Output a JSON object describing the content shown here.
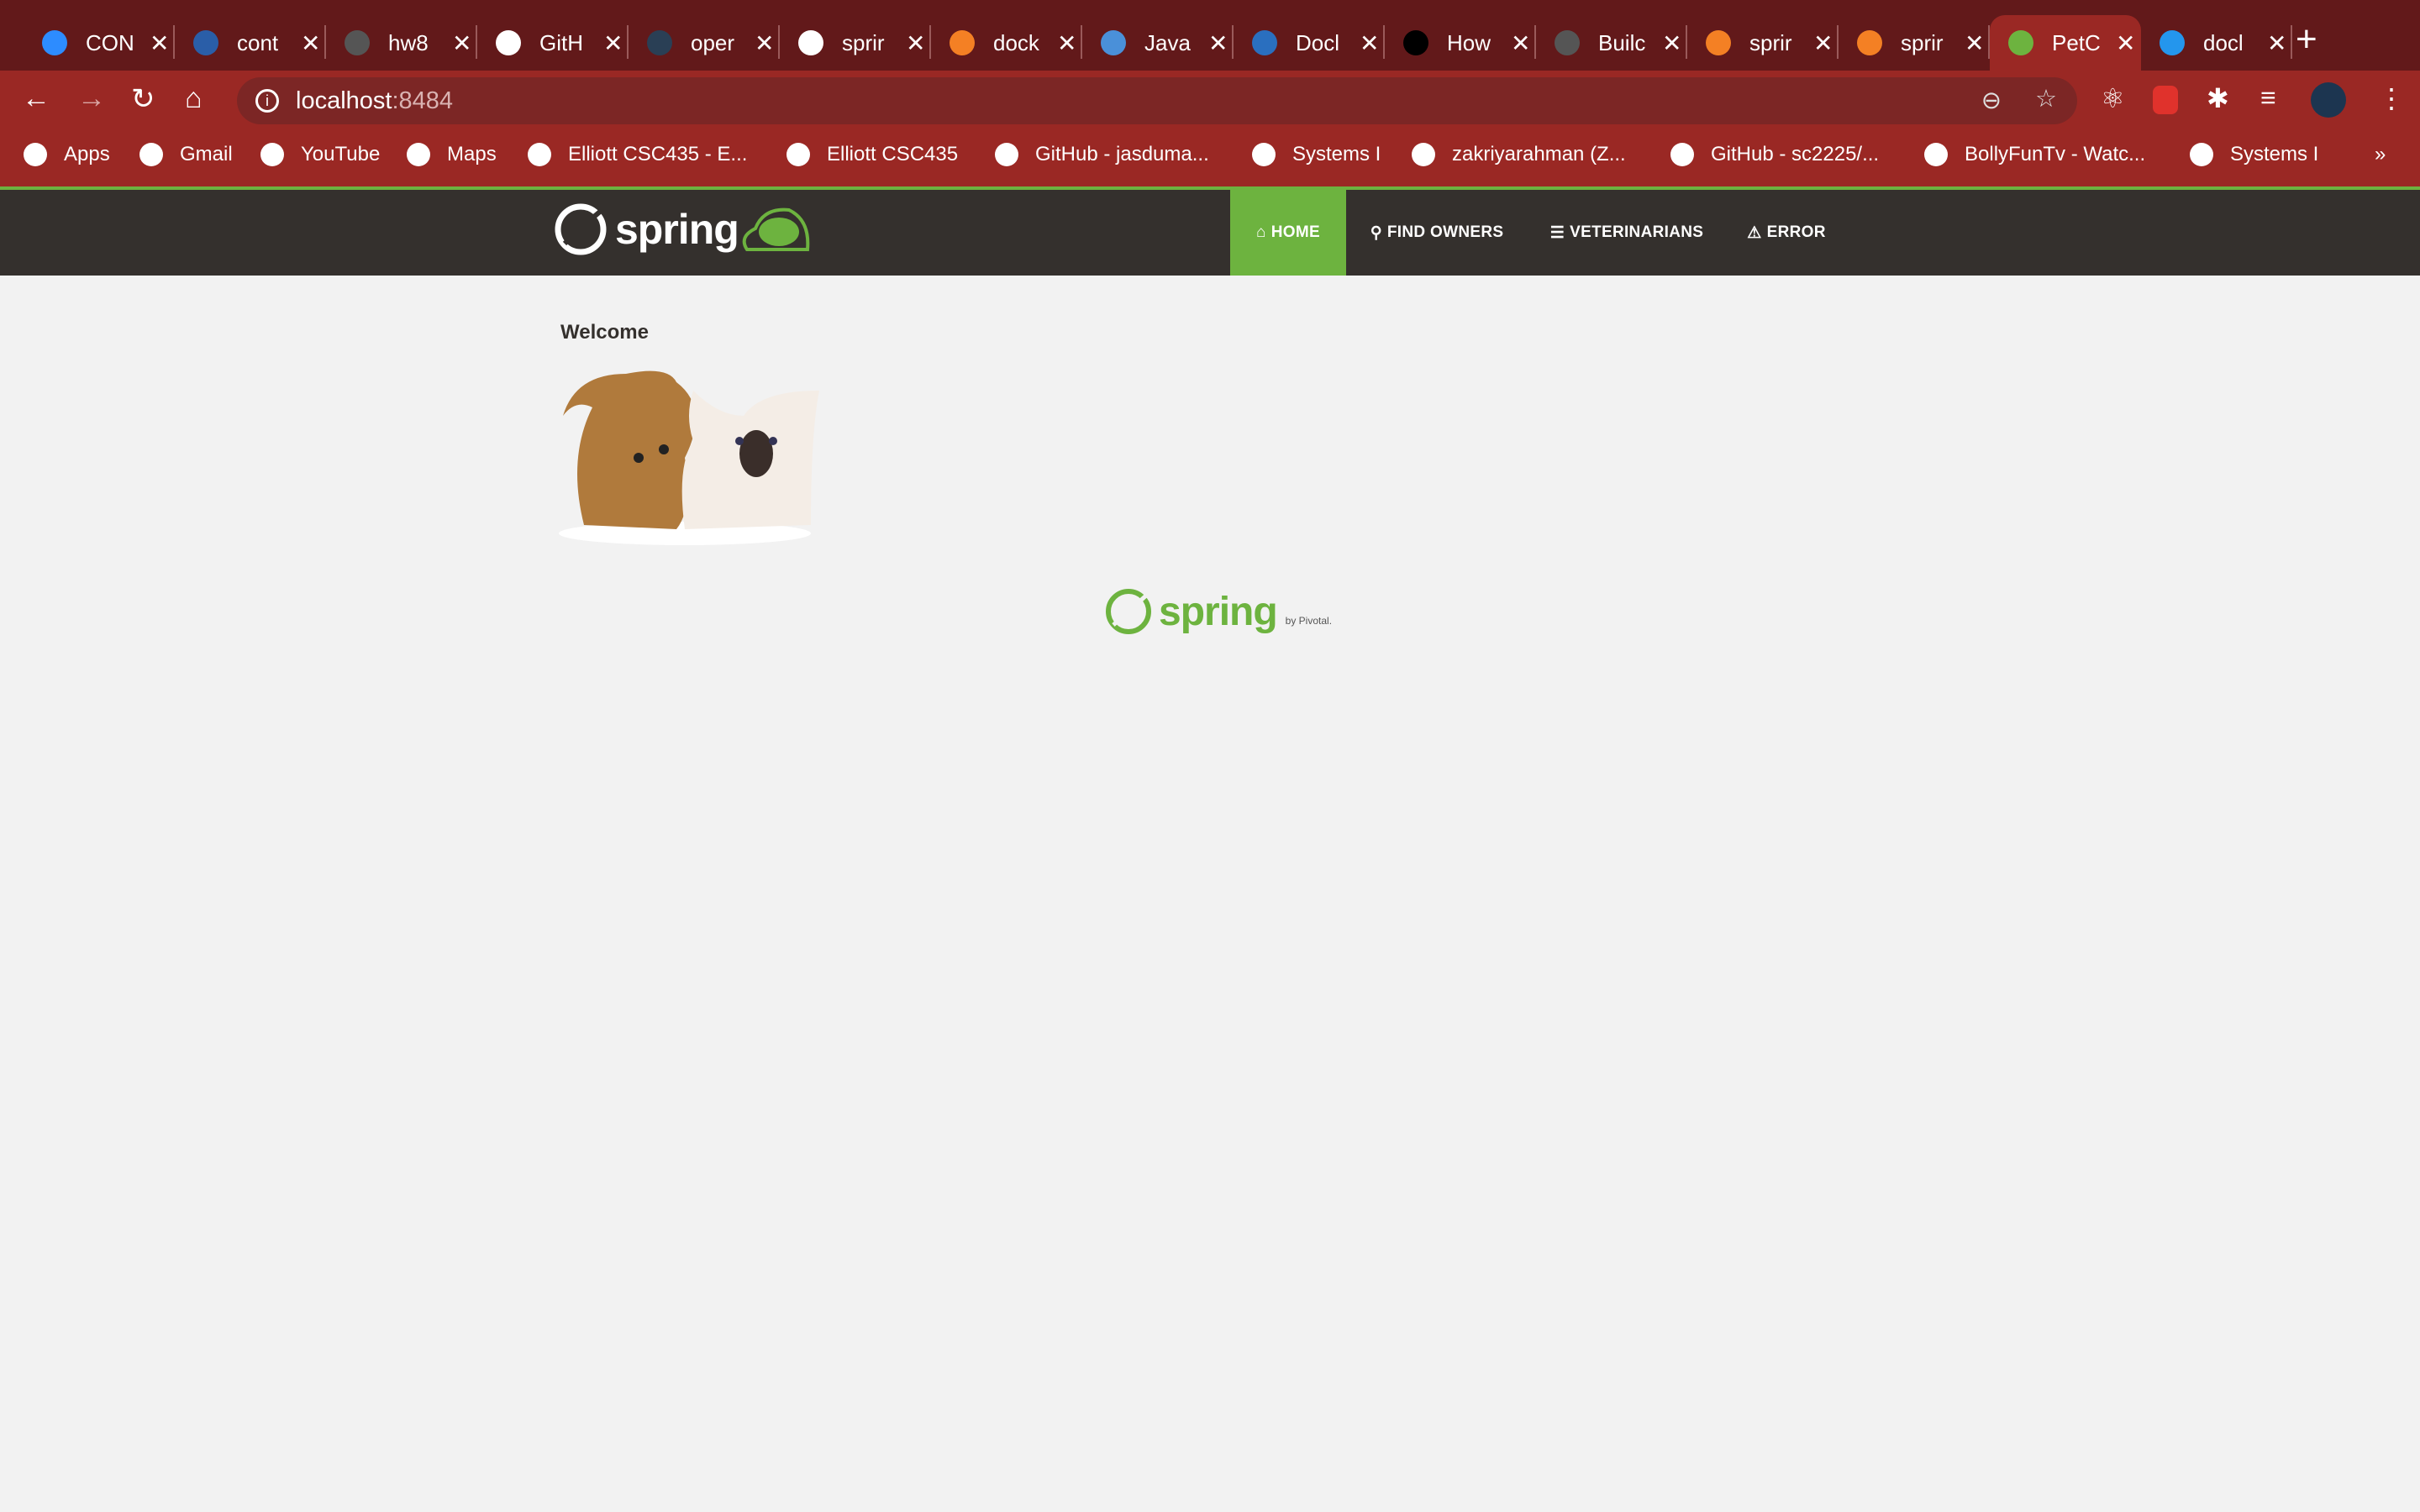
{
  "browser": {
    "tabs": [
      {
        "title": "CON",
        "icon": "zoom-icon",
        "color": "#2d8cff"
      },
      {
        "title": "cont",
        "icon": "shield-icon",
        "color": "#2a5ea8"
      },
      {
        "title": "hw8",
        "icon": "globe-icon",
        "color": "#555555"
      },
      {
        "title": "GitH",
        "icon": "github-icon",
        "color": "#ffffff"
      },
      {
        "title": "oper",
        "icon": "docker-icon",
        "color": "#2a3f55"
      },
      {
        "title": "sprir",
        "icon": "github-icon",
        "color": "#ffffff"
      },
      {
        "title": "dock",
        "icon": "stackoverflow-icon",
        "color": "#f48024"
      },
      {
        "title": "Java",
        "icon": "octopus-icon",
        "color": "#4a90d9"
      },
      {
        "title": "Docl",
        "icon": "network-icon",
        "color": "#2a6fbf"
      },
      {
        "title": "How",
        "icon": "medium-icon",
        "color": "#000000"
      },
      {
        "title": "Builc",
        "icon": "globe-icon",
        "color": "#555555"
      },
      {
        "title": "sprir",
        "icon": "stackoverflow-icon",
        "color": "#f48024"
      },
      {
        "title": "sprir",
        "icon": "stackoverflow-icon",
        "color": "#f48024"
      },
      {
        "title": "PetC",
        "icon": "spring-leaf-icon",
        "color": "#6db33f",
        "active": true
      },
      {
        "title": "docl",
        "icon": "docker-icon",
        "color": "#2496ed"
      }
    ],
    "url_host": "localhost",
    "url_port": ":8484",
    "bookmarks": [
      {
        "label": "Apps",
        "icon": "apps-grid-icon"
      },
      {
        "label": "Gmail",
        "icon": "gmail-icon"
      },
      {
        "label": "YouTube",
        "icon": "youtube-icon"
      },
      {
        "label": "Maps",
        "icon": "maps-icon"
      },
      {
        "label": "Elliott CSC435 - E...",
        "icon": "globe-icon"
      },
      {
        "label": "Elliott CSC435",
        "icon": "globe-icon"
      },
      {
        "label": "GitHub - jasduma...",
        "icon": "github-icon"
      },
      {
        "label": "Systems I",
        "icon": "globe-icon"
      },
      {
        "label": "zakriyarahman (Z...",
        "icon": "github-icon"
      },
      {
        "label": "GitHub - sc2225/...",
        "icon": "github-icon"
      },
      {
        "label": "BollyFunTv - Watc...",
        "icon": "tv-icon"
      },
      {
        "label": "Systems I",
        "icon": "globe-icon"
      }
    ],
    "more": "»"
  },
  "app": {
    "logo_text": "spring",
    "nav": [
      {
        "label": "HOME",
        "icon": "home-icon",
        "active": true
      },
      {
        "label": "FIND OWNERS",
        "icon": "search-icon"
      },
      {
        "label": "VETERINARIANS",
        "icon": "list-icon"
      },
      {
        "label": "ERROR",
        "icon": "warning-icon"
      }
    ],
    "welcome": "Welcome",
    "footer_logo": "spring",
    "footer_by": "by Pivotal.",
    "colors": {
      "accent": "#6db33f",
      "nav_bg": "#34302d",
      "chrome": "#9a2824"
    }
  }
}
